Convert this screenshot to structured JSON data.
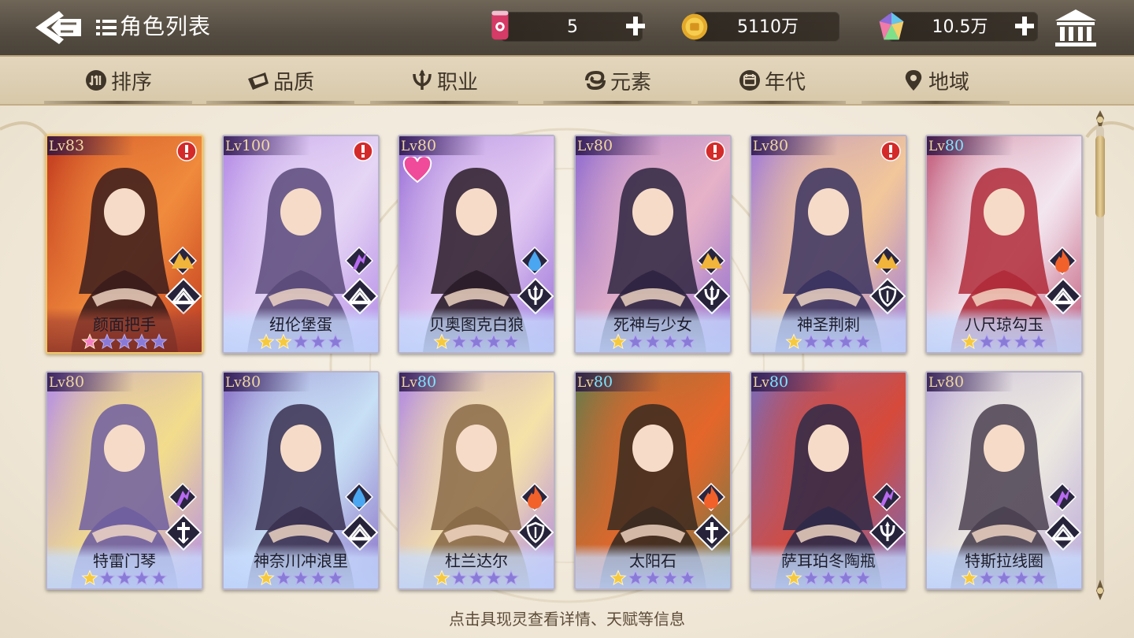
{
  "header": {
    "title": "角色列表",
    "currencies": [
      {
        "name": "stamina-drink",
        "value": "5",
        "addable": true
      },
      {
        "name": "gold-coin",
        "value": "5110万",
        "addable": false
      },
      {
        "name": "rainbow-gem",
        "value": "10.5万",
        "addable": true
      }
    ]
  },
  "filters": [
    {
      "label": "排序",
      "icon": "sort-icon"
    },
    {
      "label": "品质",
      "icon": "quality-icon"
    },
    {
      "label": "职业",
      "icon": "class-icon"
    },
    {
      "label": "元素",
      "icon": "element-icon"
    },
    {
      "label": "年代",
      "icon": "era-icon"
    },
    {
      "label": "地域",
      "icon": "region-icon"
    }
  ],
  "characters": [
    {
      "name": "颜面把手",
      "level": "83",
      "stars": 1,
      "star_style": "pink",
      "element": "earth",
      "class": "book",
      "alert": true,
      "favorite": false,
      "rarity": "gold",
      "level_color": "gold",
      "palette": [
        "#c23a1f",
        "#f08a3c",
        "#3a1c1c"
      ]
    },
    {
      "name": "纽伦堡蛋",
      "level": "100",
      "stars": 2,
      "star_style": "gold",
      "element": "lightning",
      "class": "book",
      "alert": true,
      "favorite": false,
      "rarity": "purple",
      "level_color": "gold",
      "palette": [
        "#b48ae6",
        "#e6d6f5",
        "#5a4a7a"
      ]
    },
    {
      "name": "贝奥图克白狼",
      "level": "80",
      "stars": 1,
      "star_style": "gold",
      "element": "water",
      "class": "trident",
      "alert": false,
      "favorite": true,
      "rarity": "purple",
      "level_color": "gold",
      "palette": [
        "#9a70d8",
        "#e2c9f2",
        "#2a1c28"
      ]
    },
    {
      "name": "死神与少女",
      "level": "80",
      "stars": 1,
      "star_style": "gold",
      "element": "earth",
      "class": "trident",
      "alert": true,
      "favorite": false,
      "rarity": "purple",
      "level_color": "gold",
      "palette": [
        "#8f6bd0",
        "#e6b2c8",
        "#2d2440"
      ]
    },
    {
      "name": "神圣荆刺",
      "level": "80",
      "stars": 1,
      "star_style": "gold",
      "element": "earth",
      "class": "shield",
      "alert": true,
      "favorite": false,
      "rarity": "purple",
      "level_color": "gold",
      "palette": [
        "#a07ad8",
        "#f2c79a",
        "#3a3260"
      ]
    },
    {
      "name": "八尺琼勾玉",
      "level": "80",
      "stars": 1,
      "star_style": "gold",
      "element": "fire",
      "class": "book",
      "alert": false,
      "favorite": false,
      "rarity": "purple",
      "level_color": "cyan",
      "palette": [
        "#c25a7a",
        "#f3e6ef",
        "#b02a38"
      ]
    },
    {
      "name": "特雷门琴",
      "level": "80",
      "stars": 1,
      "star_style": "gold",
      "element": "lightning",
      "class": "cross",
      "alert": false,
      "favorite": false,
      "rarity": "purple",
      "level_color": "gold",
      "palette": [
        "#b58ee6",
        "#f2dc8c",
        "#6f5ea0"
      ]
    },
    {
      "name": "神奈川冲浪里",
      "level": "80",
      "stars": 1,
      "star_style": "gold",
      "element": "water",
      "class": "book",
      "alert": false,
      "favorite": false,
      "rarity": "purple",
      "level_color": "gold",
      "palette": [
        "#8a72c8",
        "#c8e0f5",
        "#3a3050"
      ]
    },
    {
      "name": "杜兰达尔",
      "level": "80",
      "stars": 1,
      "star_style": "gold",
      "element": "fire",
      "class": "shield",
      "alert": false,
      "favorite": false,
      "rarity": "purple",
      "level_color": "cyan",
      "palette": [
        "#b28ae2",
        "#f5e2a8",
        "#8a6a48"
      ]
    },
    {
      "name": "太阳石",
      "level": "80",
      "stars": 1,
      "star_style": "gold",
      "element": "fire",
      "class": "cross",
      "alert": false,
      "favorite": false,
      "rarity": "purple",
      "level_color": "cyan",
      "palette": [
        "#6a7a4a",
        "#e4662a",
        "#3a2a20"
      ]
    },
    {
      "name": "萨耳珀冬陶瓶",
      "level": "80",
      "stars": 1,
      "star_style": "gold",
      "element": "lightning",
      "class": "trident",
      "alert": false,
      "favorite": false,
      "rarity": "purple",
      "level_color": "cyan",
      "palette": [
        "#7a6ab8",
        "#d64a3a",
        "#2e2a48"
      ]
    },
    {
      "name": "特斯拉线圈",
      "level": "80",
      "stars": 1,
      "star_style": "gold",
      "element": "lightning",
      "class": "book",
      "alert": false,
      "favorite": false,
      "rarity": "purple",
      "level_color": "gold",
      "palette": [
        "#b9a8d8",
        "#ece8e0",
        "#4a4050"
      ]
    }
  ],
  "footer": {
    "hint": "点击具现灵查看详情、天赋等信息"
  },
  "max_stars": 5,
  "colors": {
    "accent_gold": "#f1c66b",
    "level_cyan": "#7fe6ff",
    "level_gold": "#f0d9a0"
  }
}
